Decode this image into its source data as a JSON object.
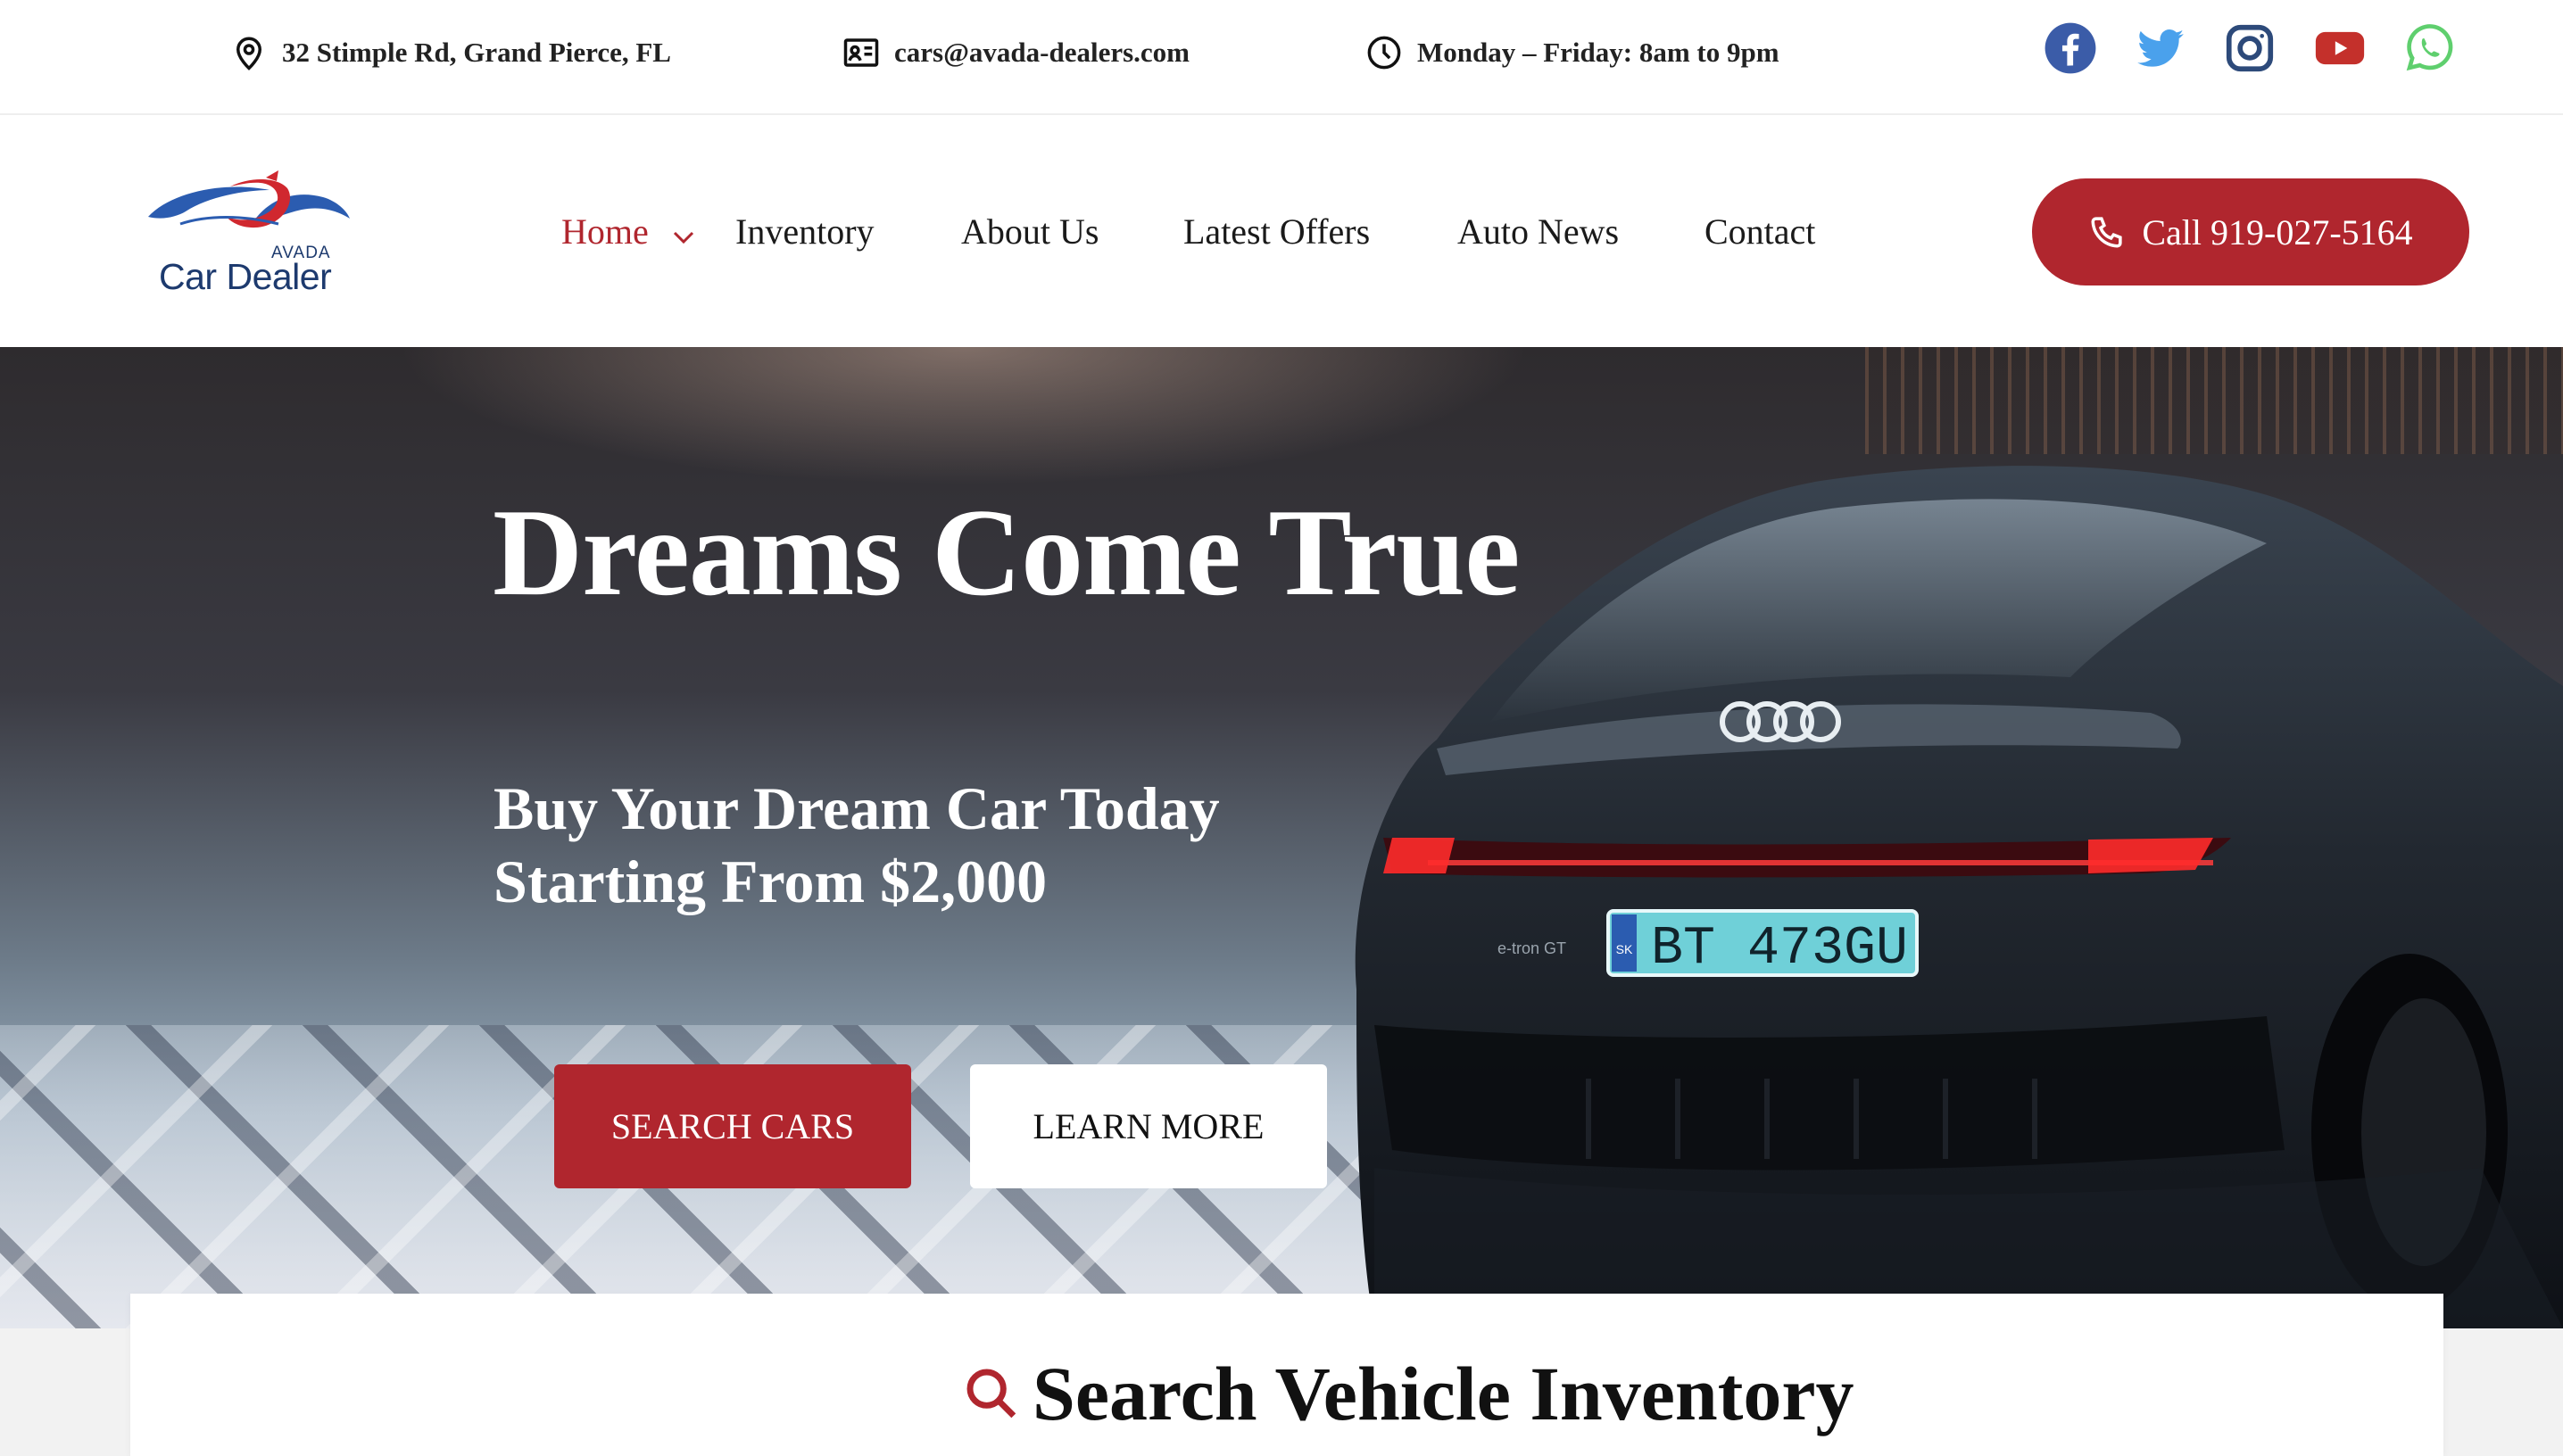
{
  "topbar": {
    "address": "32 Stimple Rd, Grand Pierce, FL",
    "email": "cars@avada-dealers.com",
    "hours": "Monday – Friday: 8am to 9pm",
    "social": [
      "facebook-icon",
      "twitter-icon",
      "instagram-icon",
      "youtube-icon",
      "whatsapp-icon"
    ],
    "colors": {
      "facebook": "#3b5ca8",
      "twitter": "#4aa1ec",
      "instagram": "#2d4a7a",
      "youtube": "#c4302b",
      "whatsapp": "#5fcf6e"
    }
  },
  "logo": {
    "small": "AVADA",
    "big": "Car Dealer"
  },
  "nav": {
    "items": [
      {
        "label": "Home",
        "active": true
      },
      {
        "label": "Inventory"
      },
      {
        "label": "About Us"
      },
      {
        "label": "Latest Offers"
      },
      {
        "label": "Auto News"
      },
      {
        "label": "Contact"
      }
    ],
    "call_label": "Call 919-027-5164"
  },
  "hero": {
    "title": "Dreams Come True",
    "subtitle_line1": "Buy Your Dream Car Today",
    "subtitle_line2": "Starting From $2,000",
    "search_button": "SEARCH CARS",
    "learn_button": "LEARN MORE",
    "plate": "BT 473GU",
    "plate_country": "SK",
    "badge": "e-tron GT"
  },
  "search": {
    "heading": "Search Vehicle Inventory"
  },
  "colors": {
    "accent": "#b0262e",
    "text": "#111111",
    "logo_blue": "#1d3a6e"
  }
}
